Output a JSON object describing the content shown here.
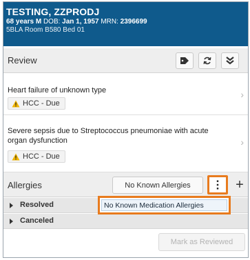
{
  "patient": {
    "name": "TESTING, ZZPRODJ",
    "age_sex": "68 years M",
    "dob_label": "DOB:",
    "dob": "Jan 1, 1957",
    "mrn_label": "MRN:",
    "mrn": "2396699",
    "location": "5BLA Room B580 Bed 01"
  },
  "review": {
    "title": "Review",
    "icons": [
      "tag-icon",
      "refresh-icon",
      "collapse-icon"
    ]
  },
  "problems": [
    {
      "text": "Heart failure of unknown type",
      "badge": "HCC - Due"
    },
    {
      "text": "Severe sepsis due to Streptococcus pneumoniae with acute organ dysfunction",
      "badge": "HCC - Due"
    }
  ],
  "allergies": {
    "title": "Allergies",
    "nka_button": "No Known Allergies",
    "plus_label": "+",
    "groups": [
      "Resolved",
      "Canceled"
    ],
    "dropdown_item": "No Known Medication Allergies"
  },
  "footer": {
    "mark_reviewed": "Mark as Reviewed"
  },
  "colors": {
    "header_bg": "#0f5a8c",
    "highlight": "#e87b1e",
    "warning": "#f0b400"
  }
}
